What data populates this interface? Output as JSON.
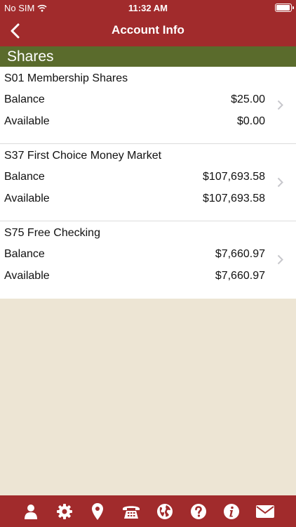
{
  "status": {
    "carrier": "No SIM",
    "time": "11:32 AM"
  },
  "nav": {
    "title": "Account Info"
  },
  "section": {
    "title": "Shares"
  },
  "accounts": [
    {
      "name": "S01 Membership Shares",
      "balance_label": "Balance",
      "balance": "$25.00",
      "available_label": "Available",
      "available": "$0.00"
    },
    {
      "name": "S37 First Choice Money Market",
      "balance_label": "Balance",
      "balance": "$107,693.58",
      "available_label": "Available",
      "available": "$107,693.58"
    },
    {
      "name": "S75 Free Checking",
      "balance_label": "Balance",
      "balance": "$7,660.97",
      "available_label": "Available",
      "available": "$7,660.97"
    }
  ],
  "colors": {
    "brand": "#a12b2c",
    "section": "#5a6b2c",
    "background": "#ede5d4"
  },
  "tabbar": {
    "icons": [
      "person-icon",
      "gear-icon",
      "location-pin-icon",
      "telephone-icon",
      "globe-icon",
      "help-icon",
      "info-icon",
      "mail-icon"
    ]
  }
}
